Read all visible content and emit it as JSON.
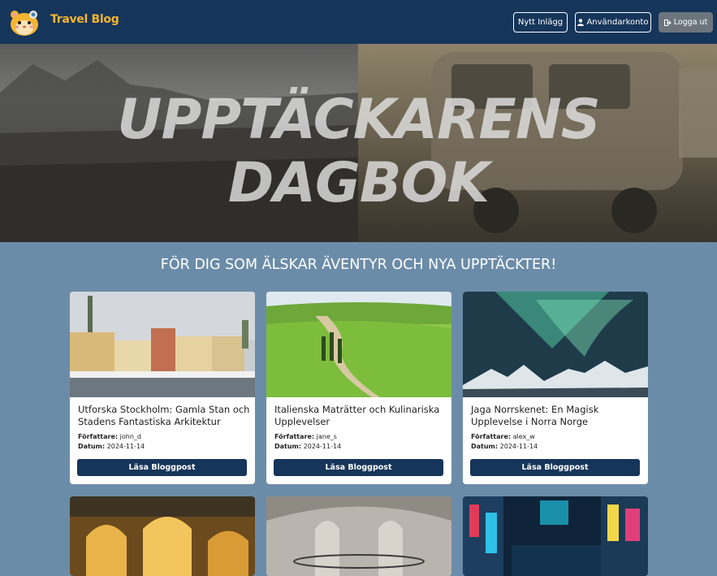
{
  "navbar": {
    "brand": "Travel Blog",
    "new_post_label": "Nytt Inlägg",
    "account_label": "Användarkonto",
    "logout_label": "Logga ut"
  },
  "hero": {
    "title_line1": "UPPTÄCKARENS",
    "title_line2": "DAGBOK"
  },
  "tagline": "FÖR DIG SOM ÄLSKAR ÄVENTYR OCH NYA UPPTÄCKTER!",
  "labels": {
    "author": "Författare:",
    "date": "Datum:",
    "read_button": "Läsa Bloggpost"
  },
  "posts": [
    {
      "title": "Utforska Stockholm: Gamla Stan och Stadens Fantastiska Arkitektur",
      "author": "john_d",
      "date": "2024-11-14"
    },
    {
      "title": "Italienska Maträtter och Kulinariska Upplevelser",
      "author": "jane_s",
      "date": "2024-11-14"
    },
    {
      "title": "Jaga Norrskenet: En Magisk Upplevelse i Norra Norge",
      "author": "alex_w",
      "date": "2024-11-14"
    }
  ],
  "colors": {
    "navbar": "#16355a",
    "brand": "#f5b532",
    "page_bg": "#6b8ca8",
    "button": "#16355a",
    "logout": "#6c757d"
  }
}
